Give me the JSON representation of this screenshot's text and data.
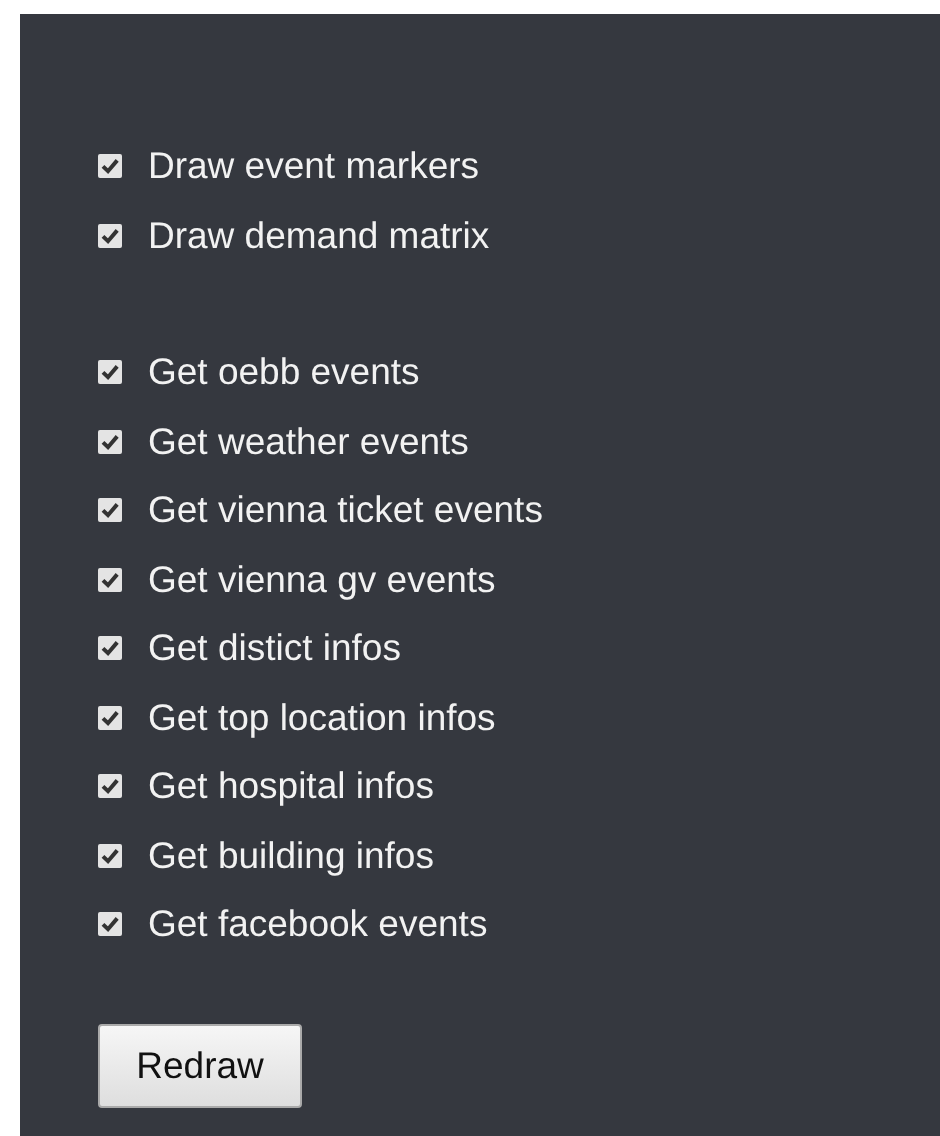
{
  "option_groups": [
    {
      "items": [
        {
          "label": "Draw event markers",
          "checked": true
        },
        {
          "label": "Draw demand matrix",
          "checked": true
        }
      ]
    },
    {
      "items": [
        {
          "label": "Get oebb events",
          "checked": true
        },
        {
          "label": "Get weather events",
          "checked": true
        },
        {
          "label": "Get vienna ticket events",
          "checked": true
        },
        {
          "label": "Get vienna gv events",
          "checked": true
        },
        {
          "label": "Get distict infos",
          "checked": true
        },
        {
          "label": "Get top location infos",
          "checked": true
        },
        {
          "label": "Get hospital infos",
          "checked": true
        },
        {
          "label": "Get building infos",
          "checked": true
        },
        {
          "label": "Get facebook events",
          "checked": true
        }
      ]
    }
  ],
  "button": {
    "label": "Redraw"
  }
}
